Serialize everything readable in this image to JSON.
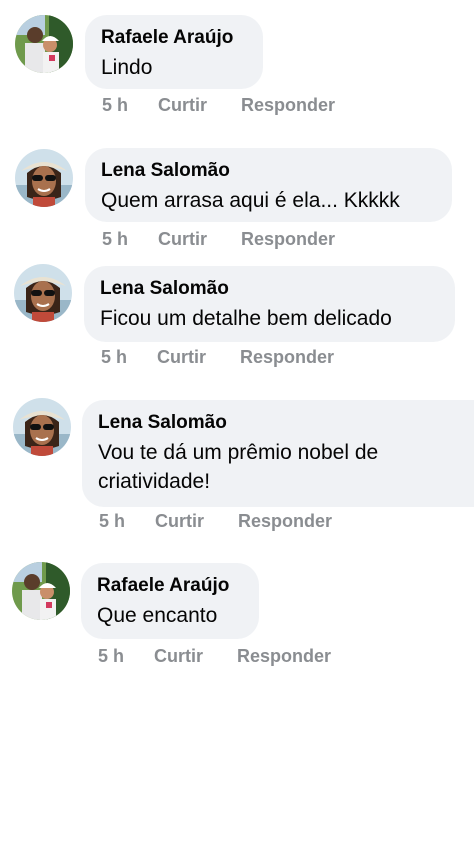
{
  "comments": [
    {
      "author": "Rafaele Araújo",
      "text": "Lindo",
      "time": "5 h",
      "like": "Curtir",
      "reply": "Responder",
      "avatar": "couple-photo"
    },
    {
      "author": "Lena Salomão",
      "text": "Quem arrasa aqui é ela... Kkkkk",
      "time": "5 h",
      "like": "Curtir",
      "reply": "Responder",
      "avatar": "woman-sunglasses-photo"
    },
    {
      "author": "Lena Salomão",
      "text": "Ficou um detalhe bem delicado",
      "time": "5 h",
      "like": "Curtir",
      "reply": "Responder",
      "avatar": "woman-sunglasses-photo"
    },
    {
      "author": "Lena Salomão",
      "text": "Vou te dá um prêmio nobel de criatividade!",
      "time": "5 h",
      "like": "Curtir",
      "reply": "Responder",
      "avatar": "woman-sunglasses-photo"
    },
    {
      "author": "Rafaele Araújo",
      "text": "Que encanto",
      "time": "5 h",
      "like": "Curtir",
      "reply": "Responder",
      "avatar": "couple-photo"
    }
  ],
  "colors": {
    "bubble": "#f0f2f5",
    "text": "#050505",
    "meta": "#8a8d91"
  }
}
